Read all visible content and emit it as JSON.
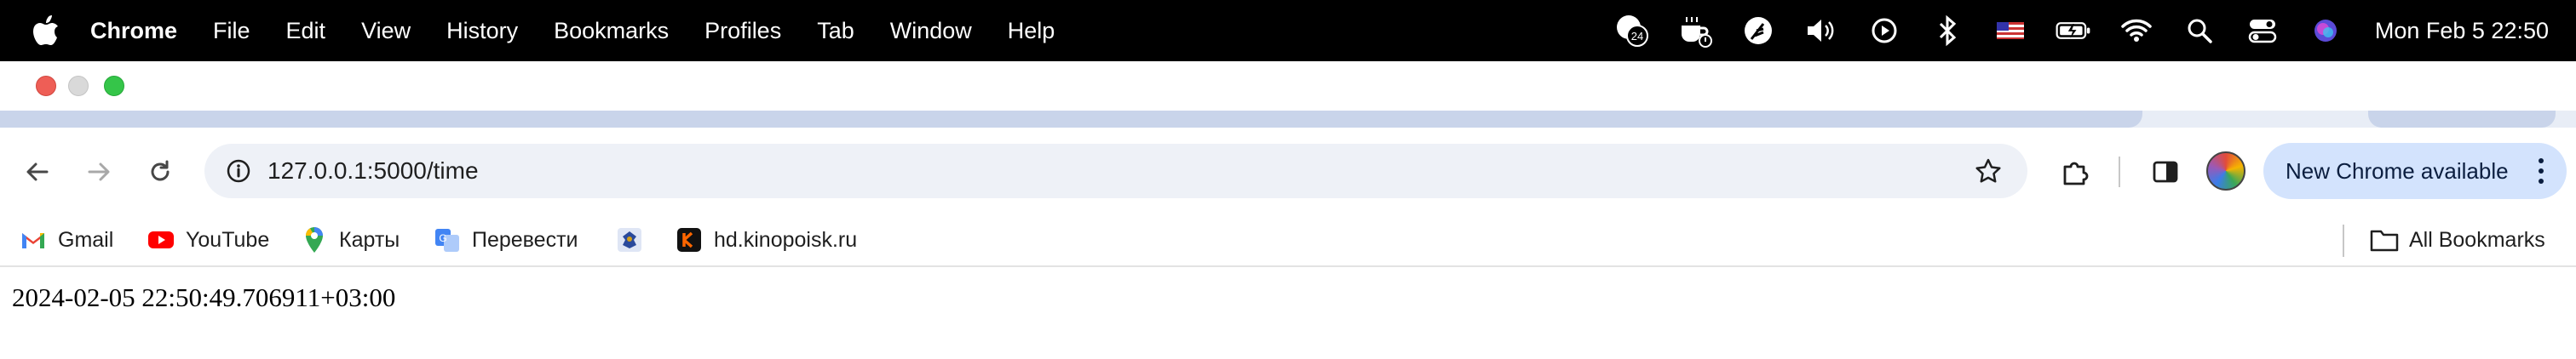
{
  "menubar": {
    "items": [
      "Chrome",
      "File",
      "Edit",
      "View",
      "History",
      "Bookmarks",
      "Profiles",
      "Tab",
      "Window",
      "Help"
    ],
    "status_icons": [
      "notification-badge-icon",
      "coffee-icon",
      "feather-icon",
      "volume-icon",
      "play-circle-icon",
      "bluetooth-icon",
      "us-flag-icon",
      "battery-charging-icon",
      "wifi-icon",
      "spotlight-search-icon",
      "control-center-icon",
      "siri-icon"
    ],
    "badge_count": "24",
    "clock": "Mon Feb 5  22:50"
  },
  "toolbar": {
    "url": "127.0.0.1:5000/time",
    "update_label": "New Chrome available"
  },
  "bookmarks": {
    "items": [
      {
        "label": "Gmail",
        "icon": "gmail-icon"
      },
      {
        "label": "YouTube",
        "icon": "youtube-icon"
      },
      {
        "label": "Карты",
        "icon": "maps-pin-icon"
      },
      {
        "label": "Перевести",
        "icon": "translate-icon"
      },
      {
        "label": "",
        "icon": "emblem-icon"
      },
      {
        "label": "hd.kinopoisk.ru",
        "icon": "kinopoisk-icon"
      }
    ],
    "all_bookmarks": "All Bookmarks"
  },
  "page": {
    "timestamp": "2024-02-05 22:50:49.706911+03:00"
  },
  "colors": {
    "update_pill": "#d3e3fd",
    "omnibox": "#eef1f7",
    "tab_band": "#c9d4ea"
  }
}
